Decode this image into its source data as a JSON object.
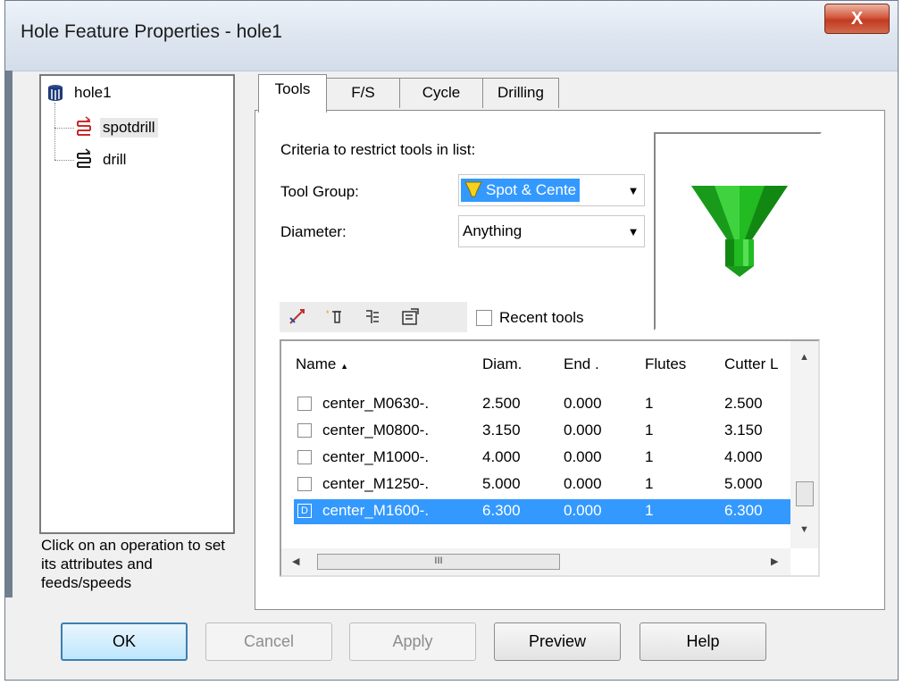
{
  "window": {
    "title": "Hole Feature Properties - hole1",
    "close_glyph": "X"
  },
  "tree": {
    "root": {
      "label": "hole1",
      "icon": "cylinder-icon"
    },
    "items": [
      {
        "label": "spotdrill",
        "icon": "spotdrill-operation-icon",
        "selected": true
      },
      {
        "label": "drill",
        "icon": "drill-operation-icon",
        "selected": false
      }
    ]
  },
  "hint": "Click on an operation to set its attributes and feeds/speeds",
  "tabs": [
    {
      "label": "Tools",
      "active": true
    },
    {
      "label": "F/S"
    },
    {
      "label": "Cycle"
    },
    {
      "label": "Drilling"
    }
  ],
  "tools_tab": {
    "criteria_label": "Criteria to restrict tools in list:",
    "tool_group_label": "Tool Group:",
    "tool_group_value": "Spot & Cente",
    "diameter_label": "Diameter:",
    "diameter_value": "Anything",
    "recent_tools_label": "Recent tools",
    "recent_tools_checked": false,
    "toolbar_icons": [
      "select-tool-icon",
      "new-tool-icon",
      "tool-database-icon",
      "tool-properties-icon"
    ],
    "preview_colors": {
      "body": "#22bb22",
      "dark": "#128812",
      "light": "#55e055"
    }
  },
  "list": {
    "columns": [
      "Name",
      "Diam.",
      "End .",
      "Flutes",
      "Cutter L"
    ],
    "sort_indicator": "▲",
    "rows": [
      {
        "name": "center_M0630-.",
        "diam": "2.500",
        "end": "0.000",
        "flutes": "1",
        "cutter": "2.500",
        "selected": false
      },
      {
        "name": "center_M0800-.",
        "diam": "3.150",
        "end": "0.000",
        "flutes": "1",
        "cutter": "3.150",
        "selected": false
      },
      {
        "name": "center_M1000-.",
        "diam": "4.000",
        "end": "0.000",
        "flutes": "1",
        "cutter": "4.000",
        "selected": false
      },
      {
        "name": "center_M1250-.",
        "diam": "5.000",
        "end": "0.000",
        "flutes": "1",
        "cutter": "5.000",
        "selected": false
      },
      {
        "name": "center_M1600-.",
        "diam": "6.300",
        "end": "0.000",
        "flutes": "1",
        "cutter": "6.300",
        "selected": true
      }
    ],
    "selected_glyph": "D",
    "hscroll_grip": "III"
  },
  "buttons": {
    "ok": "OK",
    "cancel": "Cancel",
    "apply": "Apply",
    "preview": "Preview",
    "help": "Help"
  }
}
